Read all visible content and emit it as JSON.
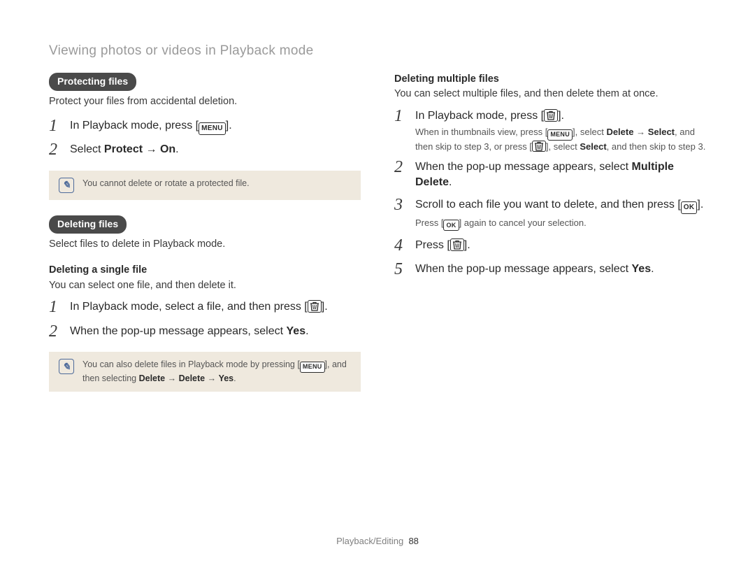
{
  "page_title": "Viewing photos or videos in Playback mode",
  "icons": {
    "menu": "MENU",
    "ok": "OK",
    "trash": "trash"
  },
  "left": {
    "protect": {
      "pill": "Protecting files",
      "desc": "Protect your files from accidental deletion.",
      "steps": [
        {
          "num": "1",
          "text_pre": "In Playback mode, press [",
          "icon": "menu",
          "text_post": "]."
        },
        {
          "num": "2",
          "text_html": "Select <b>Protect</b> → <b>On</b>."
        }
      ],
      "note": "You cannot delete or rotate a protected file."
    },
    "delete": {
      "pill": "Deleting files",
      "desc": "Select files to delete in Playback mode.",
      "single": {
        "heading": "Deleting a single file",
        "desc": "You can select one file, and then delete it.",
        "steps": [
          {
            "num": "1",
            "text_pre": "In Playback mode, select a file, and then press [",
            "icon": "trash",
            "text_post": "]."
          },
          {
            "num": "2",
            "text_html": "When the pop-up message appears, select <b>Yes</b>."
          }
        ],
        "note_pre": "You can also delete files in Playback mode by pressing [",
        "note_icon": "menu",
        "note_post": "], and then selecting <b>Delete</b> → <b>Delete</b> → <b>Yes</b>."
      }
    }
  },
  "right": {
    "multi": {
      "heading": "Deleting multiple files",
      "desc": "You can select multiple files, and then delete them at once.",
      "steps": [
        {
          "num": "1",
          "text_pre": "In Playback mode, press [",
          "icon": "trash",
          "text_post": "].",
          "sub_parts": [
            {
              "t": "When in thumbnails view, press ["
            },
            {
              "icon": "menu"
            },
            {
              "t": "], select "
            },
            {
              "b": "Delete"
            },
            {
              "t": " → "
            },
            {
              "b": "Select"
            },
            {
              "t": ", and then skip to step 3, or press ["
            },
            {
              "icon": "trash"
            },
            {
              "t": "], select "
            },
            {
              "b": "Select"
            },
            {
              "t": ", and then skip to step 3."
            }
          ]
        },
        {
          "num": "2",
          "text_html": "When the pop-up message appears, select <b>Multiple Delete</b>."
        },
        {
          "num": "3",
          "text_pre": "Scroll to each file you want to delete, and then press [",
          "icon": "ok",
          "text_post": "].",
          "sub_parts": [
            {
              "t": "Press ["
            },
            {
              "icon": "ok"
            },
            {
              "t": "] again to cancel your selection."
            }
          ]
        },
        {
          "num": "4",
          "text_pre": "Press [",
          "icon": "trash",
          "text_post": "]."
        },
        {
          "num": "5",
          "text_html": "When the pop-up message appears, select <b>Yes</b>."
        }
      ]
    }
  },
  "footer": {
    "section": "Playback/Editing",
    "page": "88"
  }
}
